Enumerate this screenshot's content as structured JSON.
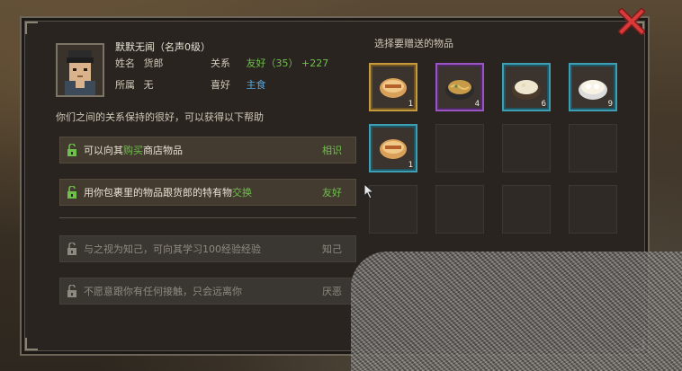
{
  "character": {
    "name": "默默无闻（名声0级）",
    "surname_label": "姓名",
    "surname_value": "货郎",
    "relation_label": "关系",
    "relation_value": "友好（35）",
    "relation_delta": "+227",
    "affiliation_label": "所属",
    "affiliation_value": "无",
    "preference_label": "喜好",
    "preference_value": "主食"
  },
  "help": {
    "description": "你们之间的关系保持的很好，可以获得以下帮助",
    "perks": [
      {
        "pre": "可以向其",
        "highlight": "购买",
        "post": "商店物品",
        "tag": "相识",
        "state": "active"
      },
      {
        "pre": "用你包裹里的物品跟货郎的特有物",
        "highlight": "交换",
        "post": "",
        "tag": "友好",
        "state": "active"
      },
      {
        "pre": "与之视为知己，可向其学习100经验经验",
        "highlight": "",
        "post": "",
        "tag": "知己",
        "state": "locked"
      },
      {
        "pre": "不愿意跟你有任何接触，只会远离你",
        "highlight": "",
        "post": "",
        "tag": "厌恶",
        "state": "locked"
      }
    ]
  },
  "gift": {
    "title": "选择要赠送的物品",
    "items": [
      {
        "icon": "burrito-icon",
        "count": "1",
        "rarity": "gold"
      },
      {
        "icon": "noodle-bowl-icon",
        "count": "4",
        "rarity": "purple"
      },
      {
        "icon": "rice-bowl-icon",
        "count": "6",
        "rarity": "teal"
      },
      {
        "icon": "dumpling-bowl-icon",
        "count": "9",
        "rarity": "teal"
      },
      {
        "icon": "burrito-icon",
        "count": "1",
        "rarity": "teal"
      }
    ]
  },
  "colors": {
    "positive": "#6ec04a",
    "highlight_blue": "#5aa6d8",
    "gold": "#c59a3c",
    "purple": "#9a55c2",
    "teal": "#3e9fb4"
  }
}
